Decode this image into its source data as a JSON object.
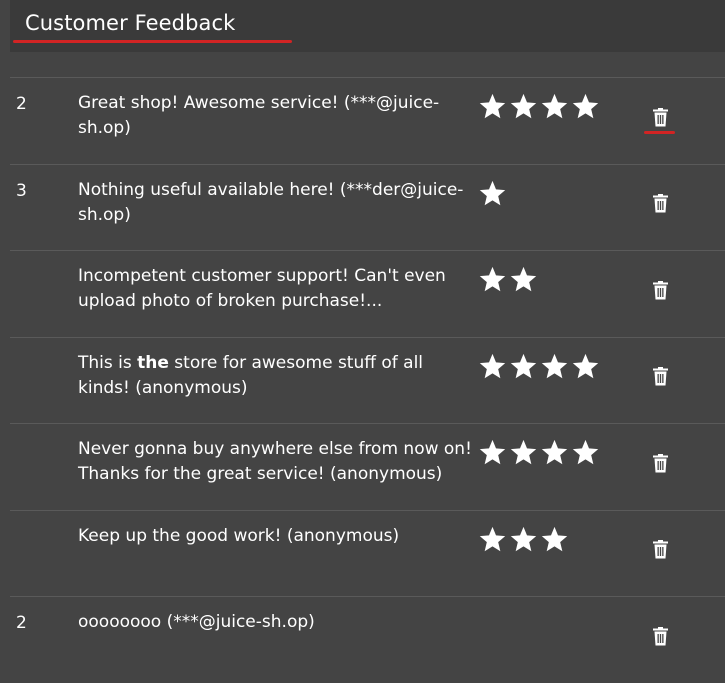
{
  "header": {
    "title": "Customer Feedback"
  },
  "feedback": [
    {
      "id": "2",
      "comment": "Great shop! Awesome service! (***@juice-sh.op)",
      "rating": 4
    },
    {
      "id": "3",
      "comment": "Nothing useful available here! (***der@juice-sh.op)",
      "rating": 1
    },
    {
      "id": "",
      "comment": "Incompetent customer support! Can't even upload photo of broken purchase!...",
      "rating": 2
    },
    {
      "id": "",
      "comment_pre": "This is ",
      "comment_bold": "the",
      "comment_post": " store for awesome stuff of all kinds! (anonymous)",
      "rating": 4
    },
    {
      "id": "",
      "comment": "Never gonna buy anywhere else from now on! Thanks for the great service! (anonymous)",
      "rating": 4
    },
    {
      "id": "",
      "comment": "Keep up the good work! (anonymous)",
      "rating": 3
    },
    {
      "id": "2",
      "comment": "oooooooo (***@juice-sh.op)",
      "rating": 0
    }
  ],
  "colors": {
    "background": "#444444",
    "header": "#3a3a3a",
    "accent": "#d22424",
    "text": "#ffffff"
  },
  "icons": {
    "rating": "star-icon",
    "delete": "trash-icon"
  }
}
